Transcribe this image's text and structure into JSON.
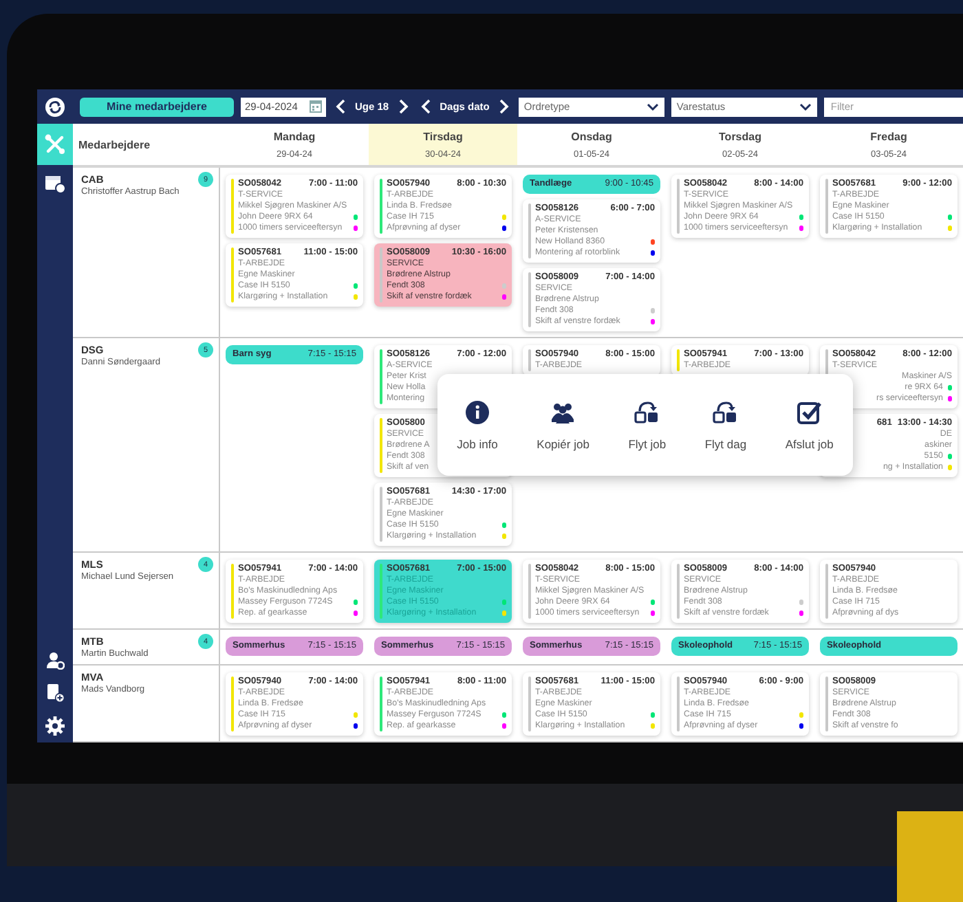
{
  "toolbar": {
    "employees_button": "Mine medarbejdere",
    "date": "29-04-2024",
    "week": "Uge 18",
    "today": "Dags dato",
    "order_type": "Ordretype",
    "item_status": "Varestatus",
    "filter": {
      "placeholder": "Filter"
    }
  },
  "sidebar": {
    "items": [
      {
        "selected": true
      },
      {
        "selected": false
      }
    ]
  },
  "header": {
    "label": "Medarbejdere",
    "days": [
      {
        "name": "Mandag",
        "date": "29-04-24",
        "selected": false
      },
      {
        "name": "Tirsdag",
        "date": "30-04-24",
        "selected": true
      },
      {
        "name": "Onsdag",
        "date": "01-05-24",
        "selected": false
      },
      {
        "name": "Torsdag",
        "date": "02-05-24",
        "selected": false
      },
      {
        "name": "Fredag",
        "date": "03-05-24",
        "selected": false
      }
    ]
  },
  "rows": [
    {
      "code": "CAB",
      "name": "Christoffer Aastrup Bach",
      "count": "9",
      "days": [
        {
          "entries": [
            {
              "kind": "job",
              "id": "SO058042",
              "time": "7:00 - 11:00",
              "color": "#f2e600",
              "lines": [
                {
                  "text": "T-SERVICE"
                },
                {
                  "text": "Mikkel Sjøgren Maskiner A/S"
                },
                {
                  "text": "John Deere 9RX 64",
                  "color": "#00e676"
                },
                {
                  "text": "1000 timers serviceeftersyn",
                  "color": "#ff00ff"
                }
              ]
            },
            {
              "kind": "job",
              "id": "SO057681",
              "time": "11:00 - 15:00",
              "color": "#f2e600",
              "lines": [
                {
                  "text": "T-ARBEJDE"
                },
                {
                  "text": "Egne Maskiner"
                },
                {
                  "text": "Case IH 5150",
                  "color": "#00e676"
                },
                {
                  "text": "Klargøring + Installation",
                  "color": "#f2e600"
                }
              ]
            }
          ]
        },
        {
          "entries": [
            {
              "kind": "job",
              "id": "SO057940",
              "time": "8:00 - 10:30",
              "color": "#2ee87a",
              "lines": [
                {
                  "text": "T-ARBEJDE"
                },
                {
                  "text": "Linda B. Fredsøe"
                },
                {
                  "text": "Case IH 715",
                  "color": "#f2e600"
                },
                {
                  "text": "Afprøvning af dyser",
                  "color": "#0000ee"
                }
              ]
            },
            {
              "kind": "alert-job",
              "id": "SO058009",
              "time": "10:30 - 16:00",
              "color": "#c8c8c8",
              "lines": [
                {
                  "text": "SERVICE"
                },
                {
                  "text": "Brødrene Alstrup"
                },
                {
                  "text": "Fendt 308",
                  "color": "#cccccc"
                },
                {
                  "text": "Skift af venstre fordæk",
                  "color": "#ff00ff"
                }
              ]
            }
          ]
        },
        {
          "entries": [
            {
              "kind": "absence",
              "label": "Tandlæge",
              "time": "9:00 - 10:45",
              "color": "#3ddccb"
            },
            {
              "kind": "job",
              "id": "SO058126",
              "time": "6:00 - 7:00",
              "color": "#c8c8c8",
              "lines": [
                {
                  "text": "A-SERVICE"
                },
                {
                  "text": "Peter Kristensen"
                },
                {
                  "text": "New Holland 8360",
                  "color": "#ff4422"
                },
                {
                  "text": "Montering af rotorblink",
                  "color": "#0000ee"
                }
              ]
            },
            {
              "kind": "job",
              "id": "SO058009",
              "time": "7:00 - 14:00",
              "color": "#c8c8c8",
              "lines": [
                {
                  "text": "SERVICE"
                },
                {
                  "text": "Brødrene Alstrup"
                },
                {
                  "text": "Fendt 308",
                  "color": "#cccccc"
                },
                {
                  "text": "Skift af venstre fordæk",
                  "color": "#ff00ff"
                }
              ]
            }
          ]
        },
        {
          "entries": [
            {
              "kind": "job",
              "id": "SO058042",
              "time": "8:00 - 14:00",
              "color": "#c8c8c8",
              "lines": [
                {
                  "text": "T-SERVICE"
                },
                {
                  "text": "Mikkel Sjøgren Maskiner A/S"
                },
                {
                  "text": "John Deere 9RX 64",
                  "color": "#00e676"
                },
                {
                  "text": "1000 timers serviceeftersyn",
                  "color": "#ff00ff"
                }
              ]
            }
          ]
        },
        {
          "entries": [
            {
              "kind": "job",
              "id": "SO057681",
              "time": "9:00 - 12:00",
              "color": "#c8c8c8",
              "lines": [
                {
                  "text": "T-ARBEJDE"
                },
                {
                  "text": "Egne Maskiner"
                },
                {
                  "text": "Case IH 5150",
                  "color": "#00e676"
                },
                {
                  "text": "Klargøring + Installation",
                  "color": "#f2e600"
                }
              ]
            }
          ]
        }
      ]
    },
    {
      "code": "DSG",
      "name": "Danni Søndergaard",
      "count": "5",
      "menu": {
        "items": [
          {
            "label": "Job info"
          },
          {
            "label": "Kopiér job"
          },
          {
            "label": "Flyt job"
          },
          {
            "label": "Flyt dag"
          },
          {
            "label": "Afslut job"
          }
        ]
      },
      "days": [
        {
          "entries": [
            {
              "kind": "absence",
              "label": "Barn syg",
              "time": "7:15 - 15:15",
              "color": "#3ddccb"
            }
          ]
        },
        {
          "entries": [
            {
              "kind": "job",
              "id": "SO058126",
              "time": "7:00 - 12:00",
              "color": "#2ee87a",
              "lines": [
                {
                  "text": "A-SERVICE"
                },
                {
                  "text": "Peter Krist"
                },
                {
                  "text": "New Holla"
                },
                {
                  "text": "Montering"
                }
              ]
            },
            {
              "kind": "job",
              "id": "SO05800",
              "color": "#f2e600",
              "lines": [
                {
                  "text": "SERVICE"
                },
                {
                  "text": "Brødrene A"
                },
                {
                  "text": "Fendt 308"
                },
                {
                  "text": "Skift af ven"
                }
              ]
            },
            {
              "kind": "job",
              "id": "SO057681",
              "time": "14:30 - 17:00",
              "color": "#c8c8c8",
              "lines": [
                {
                  "text": "T-ARBEJDE"
                },
                {
                  "text": "Egne Maskiner"
                },
                {
                  "text": "Case IH 5150",
                  "color": "#00e676"
                },
                {
                  "text": "Klargøring + Installation",
                  "color": "#f2e600"
                }
              ]
            }
          ]
        },
        {
          "entries": [
            {
              "kind": "job",
              "id": "SO057940",
              "time": "8:00 - 15:00",
              "color": "#c8c8c8",
              "lines": [
                {
                  "text": "T-ARBEJDE"
                }
              ]
            }
          ]
        },
        {
          "entries": [
            {
              "kind": "job",
              "id": "SO057941",
              "time": "7:00 - 13:00",
              "color": "#f2e600",
              "lines": [
                {
                  "text": "T-ARBEJDE"
                }
              ]
            }
          ]
        },
        {
          "entries": [
            {
              "kind": "job",
              "id": "SO058042",
              "time": "8:00 - 12:00",
              "color": "#c8c8c8",
              "cut": false,
              "lines": [
                {
                  "text": "T-SERVICE",
                  "cut": false
                },
                {
                  "text": "Maskiner A/S",
                  "cut": true
                },
                {
                  "text": "re 9RX 64",
                  "cut": true,
                  "color": "#00e676"
                },
                {
                  "text": "rs serviceeftersyn",
                  "cut": true,
                  "color": "#ff00ff"
                }
              ]
            },
            {
              "kind": "job",
              "id": "681",
              "time": "13:00 - 14:30",
              "cut": true,
              "lines": [
                {
                  "text": "DE",
                  "cut": true
                },
                {
                  "text": "askiner",
                  "cut": true
                },
                {
                  "text": "5150",
                  "cut": true,
                  "color": "#00e676"
                },
                {
                  "text": "ng + Installation",
                  "cut": true,
                  "color": "#f2e600"
                }
              ]
            }
          ]
        }
      ]
    },
    {
      "code": "MLS",
      "name": "Michael Lund Sejersen",
      "count": "4",
      "days": [
        {
          "entries": [
            {
              "kind": "job",
              "id": "SO057941",
              "time": "7:00 - 14:00",
              "color": "#f2e600",
              "lines": [
                {
                  "text": "T-ARBEJDE"
                },
                {
                  "text": "Bo's Maskinudledning Aps"
                },
                {
                  "text": "Massey Ferguson 7724S",
                  "color": "#00e676"
                },
                {
                  "text": "Rep. af gearkasse",
                  "color": "#ff00ff"
                }
              ]
            }
          ]
        },
        {
          "entries": [
            {
              "kind": "active-job",
              "id": "SO057681",
              "time": "7:00 - 15:00",
              "color": "#2ee87a",
              "lines": [
                {
                  "text": "T-ARBEJDE"
                },
                {
                  "text": "Egne Maskiner"
                },
                {
                  "text": "Case IH 5150",
                  "color": "#00e676"
                },
                {
                  "text": "Klargøring + Installation",
                  "color": "#f2e600"
                }
              ]
            }
          ]
        },
        {
          "entries": [
            {
              "kind": "job",
              "id": "SO058042",
              "time": "8:00 - 15:00",
              "color": "#c8c8c8",
              "lines": [
                {
                  "text": "T-SERVICE"
                },
                {
                  "text": "Mikkel Sjøgren Maskiner A/S"
                },
                {
                  "text": "John Deere 9RX 64",
                  "color": "#00e676"
                },
                {
                  "text": "1000 timers serviceeftersyn",
                  "color": "#ff00ff"
                }
              ]
            }
          ]
        },
        {
          "entries": [
            {
              "kind": "job",
              "id": "SO058009",
              "time": "8:00 - 14:00",
              "color": "#c8c8c8",
              "lines": [
                {
                  "text": "SERVICE"
                },
                {
                  "text": "Brødrene Alstrup"
                },
                {
                  "text": "Fendt 308",
                  "color": "#cccccc"
                },
                {
                  "text": "Skift af venstre fordæk",
                  "color": "#ff00ff"
                }
              ]
            }
          ]
        },
        {
          "entries": [
            {
              "kind": "job",
              "id": "SO057940",
              "color": "#c8c8c8",
              "lines": [
                {
                  "text": "T-ARBEJDE"
                },
                {
                  "text": "Linda B. Fredsøe"
                },
                {
                  "text": "Case IH 715"
                },
                {
                  "text": "Afprøvning af dys"
                }
              ]
            }
          ]
        }
      ]
    },
    {
      "code": "MTB",
      "name": "Martin Buchwald",
      "count": "4",
      "days": [
        {
          "entries": [
            {
              "kind": "absence",
              "label": "Sommerhus",
              "time": "7:15 - 15:15",
              "color": "#d99bd9"
            }
          ]
        },
        {
          "entries": [
            {
              "kind": "absence",
              "label": "Sommerhus",
              "time": "7:15 - 15:15",
              "color": "#d99bd9"
            }
          ]
        },
        {
          "entries": [
            {
              "kind": "absence",
              "label": "Sommerhus",
              "time": "7:15 - 15:15",
              "color": "#d99bd9"
            }
          ]
        },
        {
          "entries": [
            {
              "kind": "absence",
              "label": "Skoleophold",
              "time": "7:15 - 15:15",
              "color": "#3ddccb"
            }
          ]
        },
        {
          "entries": [
            {
              "kind": "absence",
              "label": "Skoleophold",
              "color": "#3ddccb"
            }
          ]
        }
      ]
    },
    {
      "code": "MVA",
      "name": "Mads Vandborg",
      "days": [
        {
          "entries": [
            {
              "kind": "job",
              "id": "SO057940",
              "time": "7:00 - 14:00",
              "color": "#f2e600",
              "lines": [
                {
                  "text": "T-ARBEJDE"
                },
                {
                  "text": "Linda B. Fredsøe"
                },
                {
                  "text": "Case IH 715",
                  "color": "#f2e600"
                },
                {
                  "text": "Afprøvning af dyser",
                  "color": "#0000ee"
                }
              ]
            }
          ]
        },
        {
          "entries": [
            {
              "kind": "job",
              "id": "SO057941",
              "time": "8:00 - 11:00",
              "color": "#2ee87a",
              "lines": [
                {
                  "text": "T-ARBEJDE"
                },
                {
                  "text": "Bo's Maskinudledning Aps"
                },
                {
                  "text": "Massey Ferguson 7724S",
                  "color": "#00e676"
                },
                {
                  "text": "Rep. af gearkasse",
                  "color": "#ff00ff"
                }
              ]
            }
          ]
        },
        {
          "entries": [
            {
              "kind": "job",
              "id": "SO057681",
              "time": "11:00 - 15:00",
              "color": "#c8c8c8",
              "lines": [
                {
                  "text": "T-ARBEJDE"
                },
                {
                  "text": "Egne Maskiner"
                },
                {
                  "text": "Case IH 5150",
                  "color": "#00e676"
                },
                {
                  "text": "Klargøring + Installation",
                  "color": "#f2e600"
                }
              ]
            }
          ]
        },
        {
          "entries": [
            {
              "kind": "job",
              "id": "SO057940",
              "time": "6:00 - 9:00",
              "color": "#c8c8c8",
              "lines": [
                {
                  "text": "T-ARBEJDE"
                },
                {
                  "text": "Linda B. Fredsøe"
                },
                {
                  "text": "Case IH 715",
                  "color": "#f2e600"
                },
                {
                  "text": "Afprøvning af dyser",
                  "color": "#0000ee"
                }
              ]
            }
          ]
        },
        {
          "entries": [
            {
              "kind": "job",
              "id": "SO058009",
              "color": "#c8c8c8",
              "lines": [
                {
                  "text": "SERVICE"
                },
                {
                  "text": "Brødrene Alstrup"
                },
                {
                  "text": "Fendt 308"
                },
                {
                  "text": "Skift af venstre fo"
                }
              ]
            }
          ]
        }
      ]
    }
  ]
}
